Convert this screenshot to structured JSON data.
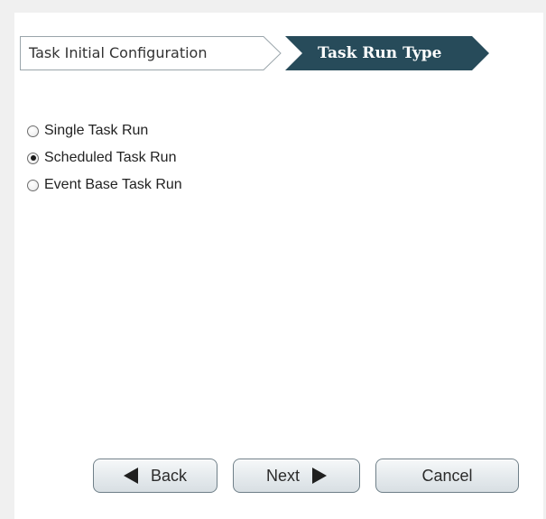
{
  "breadcrumb": {
    "steps": [
      {
        "label": "Task Initial Configuration",
        "active": false
      },
      {
        "label": "Task Run Type",
        "active": true
      }
    ]
  },
  "run_type": {
    "options": [
      {
        "label": "Single Task Run",
        "checked": false
      },
      {
        "label": "Scheduled Task Run",
        "checked": true
      },
      {
        "label": "Event Base Task Run",
        "checked": false
      }
    ]
  },
  "buttons": {
    "back_label": "Back",
    "next_label": "Next",
    "cancel_label": "Cancel"
  },
  "colors": {
    "active_step_fill": "#274b5a",
    "inactive_step_border": "#9aa5ab"
  },
  "icons": {
    "back": "triangle-left-icon",
    "next": "triangle-right-icon"
  }
}
